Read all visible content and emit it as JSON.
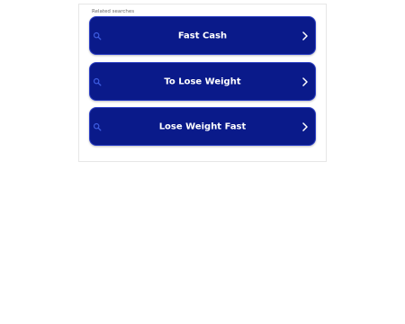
{
  "related_searches": {
    "heading": "Related searches",
    "items": [
      {
        "label": "Fast Cash",
        "icon": "search-icon",
        "action_icon": "chevron-right-icon"
      },
      {
        "label": "To Lose Weight",
        "icon": "search-icon",
        "action_icon": "chevron-right-icon"
      },
      {
        "label": "Lose Weight Fast",
        "icon": "search-icon",
        "action_icon": "chevron-right-icon"
      }
    ]
  },
  "colors": {
    "button_background": "#0a1a8a",
    "button_border": "#2c3fc4",
    "search_icon": "#3d5ce0",
    "label_text": "#ffffff",
    "heading_text": "#6b6b6b"
  }
}
